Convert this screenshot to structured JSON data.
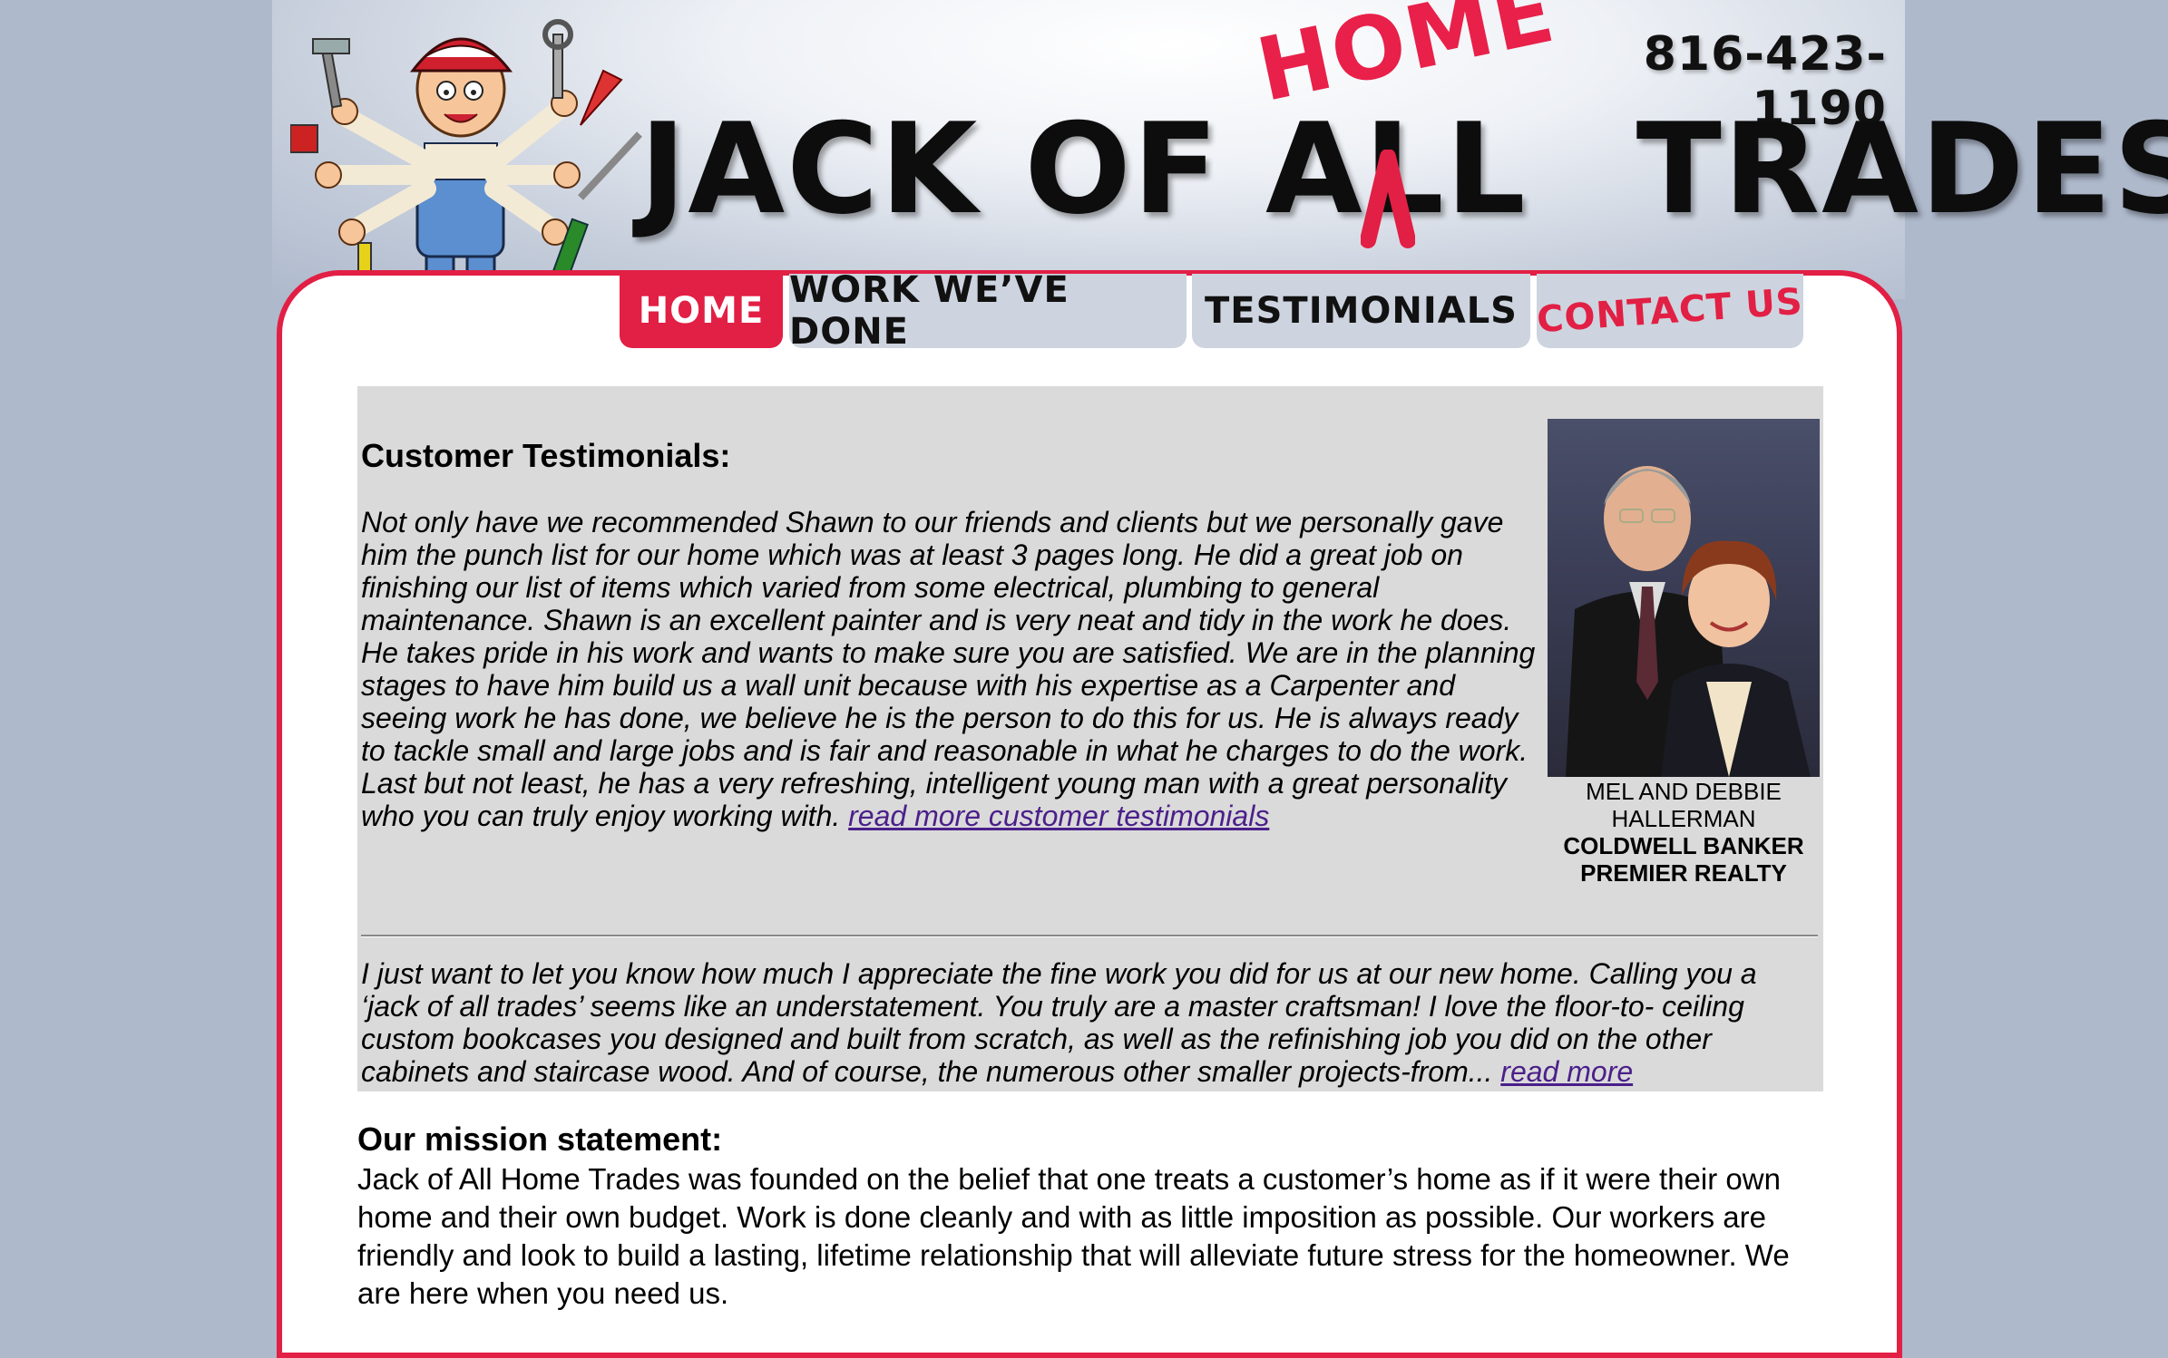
{
  "header": {
    "phone": "816-423-1190",
    "logo_main": "JACK OF ALL",
    "logo_trades": "TRADES",
    "logo_home": "HOME"
  },
  "nav": {
    "home": "HOME",
    "work": "WORK WE’VE DONE",
    "testimonials": "TESTIMONIALS",
    "contact": "CONTACT US"
  },
  "testimonials": {
    "title": "Customer Testimonials:",
    "quote1": "Not only have we recommended Shawn to our friends and clients but we personally gave him the punch list for our home which was at least 3 pages long. He did a great job on finishing our list of items which varied from some electrical, plumbing to general maintenance. Shawn is an excellent painter and is very neat and tidy in the work he does. He takes pride in his work and wants to make sure you are satisfied. We are in the planning stages to have him build us a wall unit because with his expertise as a Carpenter and seeing work he has done, we believe he is the person to do this for us. He is always ready to tackle small and large jobs and is fair and reasonable in what he charges to do the work. Last but not least, he has a very refreshing, intelligent young man with a great personality who you can truly enjoy working with.",
    "quote1_link": "read more customer testimonials",
    "caption_names": "MEL AND DEBBIE HALLERMAN",
    "caption_company": "COLDWELL BANKER PREMIER REALTY",
    "quote2": "I just want to let you know how much I appreciate the fine work you did for us at our new home. Calling you a ‘jack of all trades’ seems like an understatement. You truly are a master craftsman! I love the floor-to- ceiling custom bookcases you designed and built from scratch, as well as the refinishing job you did on the other cabinets and staircase wood. And of course, the numerous other smaller projects-from...",
    "quote2_link": "read more"
  },
  "mission": {
    "title": "Our mission statement:",
    "text": "Jack of All Home Trades was founded on the belief that one treats a customer’s home as if it were their own home and their own budget. Work is done cleanly and with as little imposition as possible. Our workers are friendly and look to build a lasting, lifetime relationship that will alleviate future stress for the homeowner. We are here when you need us."
  },
  "colors": {
    "brand_red": "#e21f44",
    "background": "#aeb9cc",
    "tab_gray": "#cdd4df",
    "box_gray": "#dadada",
    "link_purple": "#4b1f8a"
  },
  "icons": {
    "mascot": "handyman-mascot-icon",
    "caret": "caret-icon"
  }
}
